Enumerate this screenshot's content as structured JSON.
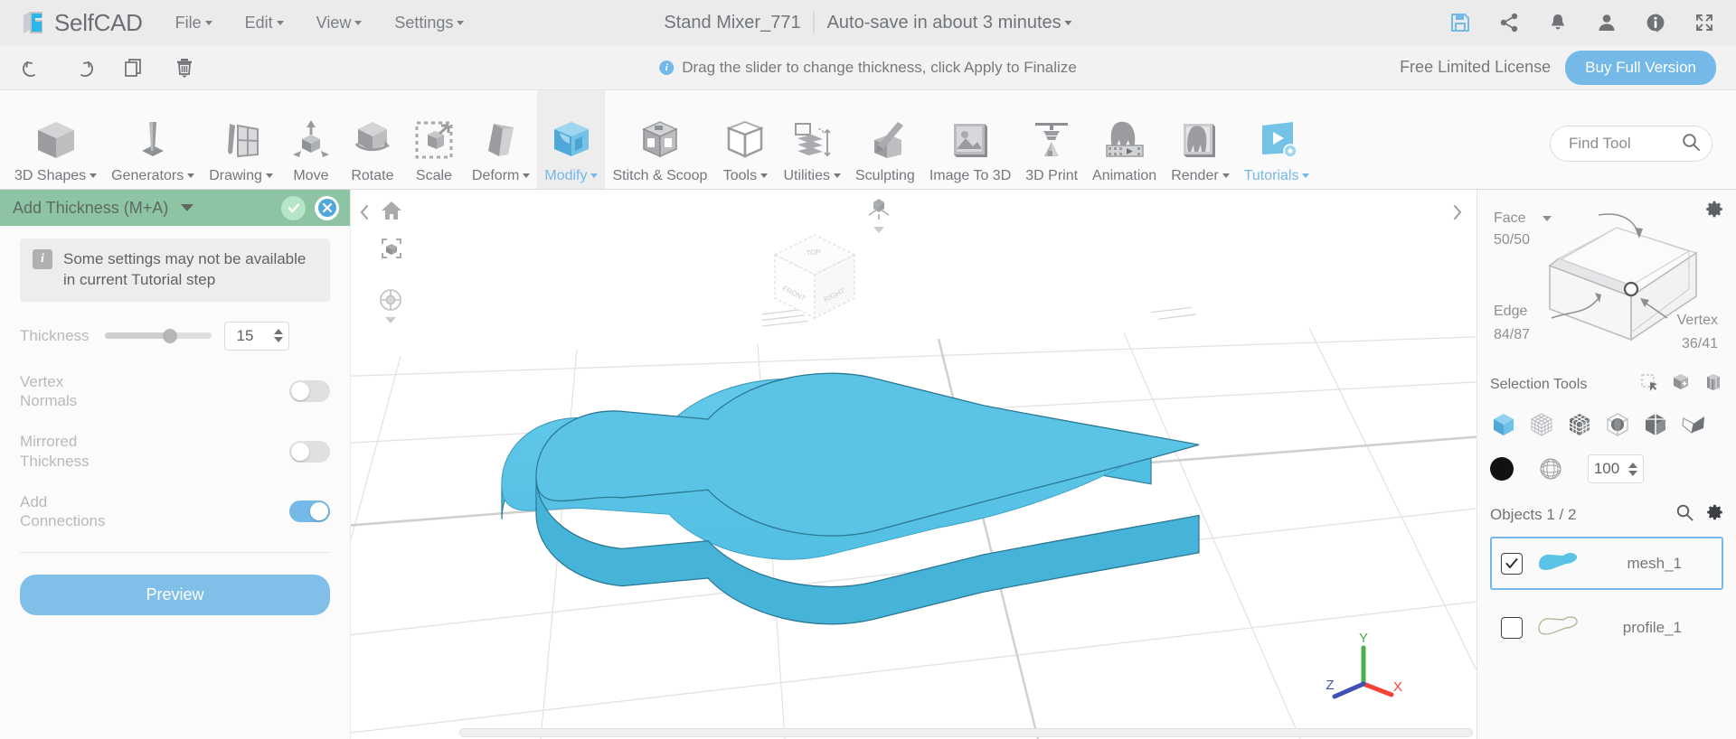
{
  "topbar": {
    "brand": "SelfCAD",
    "menus": [
      {
        "label": "File",
        "has_caret": true
      },
      {
        "label": "Edit",
        "has_caret": true
      },
      {
        "label": "View",
        "has_caret": true
      },
      {
        "label": "Settings",
        "has_caret": true
      }
    ],
    "document_title": "Stand Mixer_771",
    "autosave_text": "Auto-save in about 3 minutes",
    "icons": [
      {
        "name": "save-icon",
        "color": "#74b9e7"
      },
      {
        "name": "share-icon",
        "color": "#6f7276"
      },
      {
        "name": "notifications-bell-icon",
        "color": "#6f7276"
      },
      {
        "name": "user-account-icon",
        "color": "#6f7276"
      },
      {
        "name": "info-icon",
        "color": "#6f7276"
      },
      {
        "name": "fullscreen-icon",
        "color": "#6f7276"
      }
    ]
  },
  "secondbar": {
    "history_icons": [
      "undo-icon",
      "redo-icon",
      "copy-icon",
      "delete-icon"
    ],
    "hint": "Drag the slider to change thickness, click Apply to Finalize",
    "license_text": "Free Limited License",
    "buy_label": "Buy Full Version"
  },
  "ribbon": {
    "items": [
      {
        "label": "3D Shapes",
        "icon": "cube-icon",
        "caret": true,
        "active": false
      },
      {
        "label": "Generators",
        "icon": "cone-extrude-icon",
        "caret": true,
        "active": false
      },
      {
        "label": "Drawing",
        "icon": "pencil-sketch-icon",
        "caret": true,
        "active": false
      },
      {
        "label": "Move",
        "icon": "move-arrows-icon",
        "caret": false,
        "active": false
      },
      {
        "label": "Rotate",
        "icon": "rotate-cube-icon",
        "caret": false,
        "active": false
      },
      {
        "label": "Scale",
        "icon": "scale-cube-icon",
        "caret": false,
        "active": false
      },
      {
        "label": "Deform",
        "icon": "deform-cube-icon",
        "caret": true,
        "active": false
      },
      {
        "label": "Modify",
        "icon": "modify-cube-icon",
        "caret": true,
        "active": true
      },
      {
        "label": "Stitch & Scoop",
        "icon": "stitch-scoop-icon",
        "caret": false,
        "active": false
      },
      {
        "label": "Tools",
        "icon": "tools-cube-icon",
        "caret": true,
        "active": false
      },
      {
        "label": "Utilities",
        "icon": "utilities-layers-icon",
        "caret": true,
        "active": false
      },
      {
        "label": "Sculpting",
        "icon": "sculpting-brush-icon",
        "caret": false,
        "active": false
      },
      {
        "label": "Image To 3D",
        "icon": "image-to-3d-icon",
        "caret": false,
        "active": false
      },
      {
        "label": "3D Print",
        "icon": "3d-printer-icon",
        "caret": false,
        "active": false
      },
      {
        "label": "Animation",
        "icon": "animation-film-icon",
        "caret": false,
        "active": false
      },
      {
        "label": "Render",
        "icon": "render-image-icon",
        "caret": true,
        "active": false
      },
      {
        "label": "Tutorials",
        "icon": "tutorials-video-icon",
        "caret": true,
        "active": false,
        "blue": true
      }
    ],
    "find_tool_placeholder": "Find Tool",
    "find_tool_value": ""
  },
  "left_panel": {
    "title": "Add Thickness (M+A)",
    "confirm_icon": "checkmark-icon",
    "cancel_icon": "close-icon",
    "notice": "Some settings may not be available in current Tutorial step",
    "thickness_label": "Thickness",
    "thickness_value": "15",
    "slider_percent": 61,
    "toggles": [
      {
        "label": "Vertex Normals",
        "on": false
      },
      {
        "label": "Mirrored Thickness",
        "on": false
      },
      {
        "label": "Add Connections",
        "on": true
      }
    ],
    "preview_label": "Preview"
  },
  "viewport": {
    "home_icon": "home-icon",
    "fit_icon": "zoom-to-fit-icon",
    "perspective_icon": "perspective-view-icon",
    "pan_icon": "pan-orbit-icon",
    "navcube_faces": {
      "top": "TOP",
      "front": "FRONT",
      "right": "RIGHT"
    },
    "axes": [
      {
        "label": "Y",
        "color": "#4caf50"
      },
      {
        "label": "X",
        "color": "#f44336"
      },
      {
        "label": "Z",
        "color": "#3f51b5"
      }
    ],
    "mesh_color": "#5bc4e6",
    "collapse_left_icon": "chevron-left-icon",
    "collapse_right_icon": "chevron-right-icon"
  },
  "right_panel": {
    "gear_icon": "settings-gear-icon",
    "elements": {
      "face_label": "Face",
      "face_count": "50/50",
      "edge_label": "Edge",
      "edge_count": "84/87",
      "vertex_label": "Vertex",
      "vertex_count": "36/41"
    },
    "selection_title": "Selection Tools",
    "selection_mini_icons": [
      "rect-select-icon",
      "add-select-icon",
      "box-select-icon"
    ],
    "selection_modes": [
      {
        "name": "object-select-icon",
        "active": true
      },
      {
        "name": "vertex-select-icon",
        "active": false
      },
      {
        "name": "face-grid-select-icon",
        "active": false
      },
      {
        "name": "sphere-select-icon",
        "active": false
      },
      {
        "name": "half-cube-select-icon",
        "active": false
      },
      {
        "name": "polygon-lasso-select-icon",
        "active": false
      }
    ],
    "brush_solid_icon": "solid-brush-icon",
    "brush_mesh_icon": "mesh-brush-icon",
    "brush_size": "100",
    "objects_title": "Objects 1 / 2",
    "objects_search_icon": "search-icon",
    "objects_gear_icon": "settings-gear-icon",
    "objects": [
      {
        "name": "mesh_1",
        "checked": true,
        "selected": true,
        "thumb": "mesh-solid-thumb"
      },
      {
        "name": "profile_1",
        "checked": false,
        "selected": false,
        "thumb": "profile-outline-thumb"
      }
    ]
  },
  "colors": {
    "accent_blue": "#74b9e7",
    "panel_header_green": "#8cc4a4",
    "mesh_blue": "#5bc4e6",
    "topbar_bg": "#ebebeb"
  }
}
